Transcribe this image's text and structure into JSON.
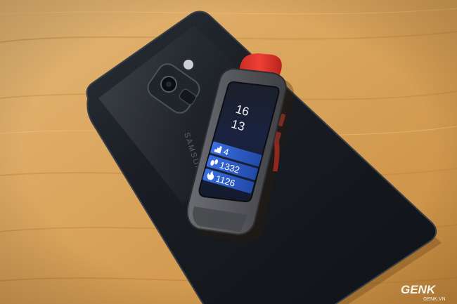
{
  "band": {
    "time_hour": "16",
    "time_minute": "13",
    "brand_text": "SAMSUNG",
    "floors": "4",
    "steps": "1332",
    "calories": "1126"
  },
  "watermark": {
    "logo": "GENK",
    "site": "GENK.VN"
  },
  "colors": {
    "table_wood": "#d9a55c",
    "phone_body": "#15191e",
    "band_strap": "#5a5b60",
    "strap_accent": "#e2362d",
    "screen_blue": "#2e5fc8"
  },
  "icons": {
    "floors": "stairs-icon",
    "steps": "footprint-icon",
    "calories": "flame-icon"
  }
}
